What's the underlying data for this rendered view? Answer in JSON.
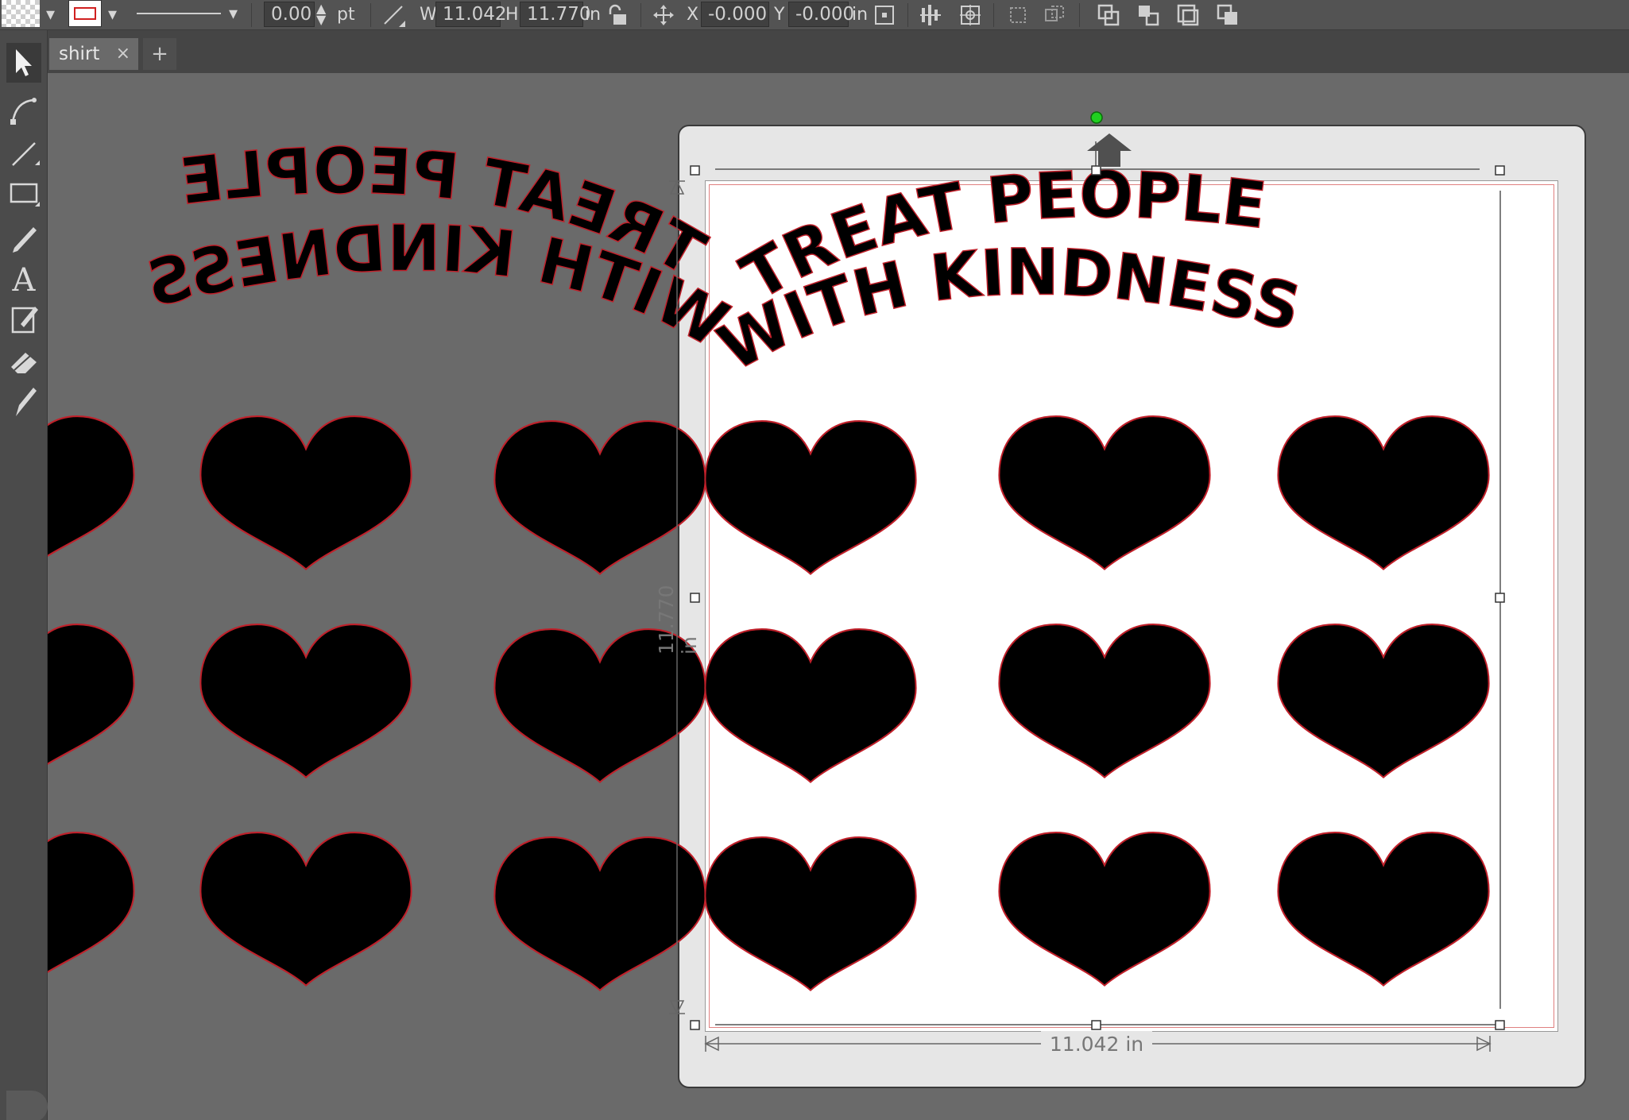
{
  "toolbar": {
    "stroke_width": "0.00",
    "stroke_unit": "pt",
    "w_label": "W",
    "w_value": "11.042",
    "h_label": "H",
    "h_value": "11.770",
    "size_unit": "in",
    "x_label": "X",
    "x_value": "-0.000",
    "y_label": "Y",
    "y_value": "-0.000",
    "pos_unit": "in"
  },
  "tabs": [
    {
      "label": "shirt"
    }
  ],
  "tab_close": "×",
  "tab_add": "+",
  "design": {
    "line1": "TREAT PEOPLE",
    "line2": "WITH KINDNESS"
  },
  "mat": {
    "width_label": "11.042 in",
    "height_label": "11.770 in"
  },
  "colors": {
    "outline": "#c0202a",
    "selection_handle": "#ffffff",
    "rotate_handle": "#20d020"
  }
}
